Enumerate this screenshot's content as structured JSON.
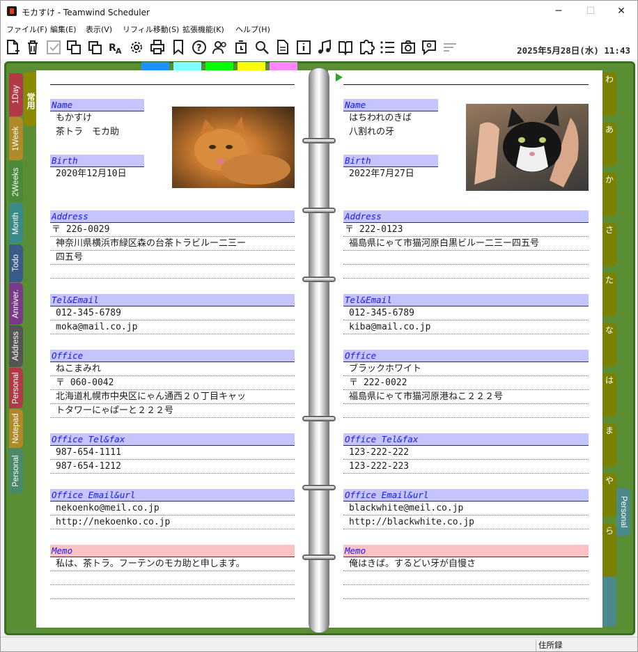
{
  "window": {
    "title": "モカすけ - Teamwind Scheduler",
    "minimize": "─",
    "maximize": "☐",
    "close": "✕"
  },
  "menu": [
    "ファイル(F)",
    "編集(E)",
    "表示(V)",
    "リフィル移動(S)",
    "拡張機能(K)",
    "ヘルプ(H)"
  ],
  "toolbar": {
    "icons": [
      "new-page-icon",
      "trash-icon",
      "check-icon",
      "copy-icon",
      "duplicate-icon",
      "spellcheck-icon",
      "gear-icon",
      "print-icon",
      "bookmark-icon",
      "help-icon",
      "users-icon",
      "alarm-icon",
      "search-icon",
      "document-icon",
      "info-icon",
      "music-icon",
      "book-icon",
      "puzzle-icon",
      "list-icon",
      "camera-icon",
      "comment-icon",
      "align-icon"
    ],
    "clock": "2025年5月28日(水) 11:43"
  },
  "tabs": {
    "left": [
      {
        "label": "常用",
        "color": "#8a8a00"
      },
      {
        "label": "1Day",
        "color": "#b23a48"
      },
      {
        "label": "1Week",
        "color": "#b08a2a"
      },
      {
        "label": "2Weeks",
        "color": "#4a8a3a"
      },
      {
        "label": "Month",
        "color": "#3a8a8a"
      },
      {
        "label": "Todo",
        "color": "#3a5a8a"
      },
      {
        "label": "Anniver.",
        "color": "#7a3a8a"
      },
      {
        "label": "Address",
        "color": "#555555"
      },
      {
        "label": "Personal",
        "color": "#b23a48"
      },
      {
        "label": "Notepad",
        "color": "#b08a2a"
      },
      {
        "label": "Personal",
        "color": "#4a8a6a"
      }
    ],
    "right": [
      "わ",
      "あ",
      "か",
      "さ",
      "た",
      "な",
      "は",
      "ま",
      "や",
      "ら"
    ],
    "right_bottom": "Personal",
    "color_tabs": [
      "#1e90ff",
      "#7fffff",
      "#00ff00",
      "#ffff00",
      "#ff88ff"
    ]
  },
  "left": {
    "name_label": "Name",
    "name1": "もかすけ",
    "name2": "茶トラ　モカ助",
    "birth_label": "Birth",
    "birth": "2020年12月10日",
    "address_label": "Address",
    "zip": "〒 226-0029",
    "addr1": "神奈川県横浜市緑区森の台茶トラビルー二三ー",
    "addr2": "四五号",
    "tel_label": "Tel&Email",
    "tel": "012-345-6789",
    "email": "moka@mail.co.jp",
    "office_label": "Office",
    "office_name": "ねこまみれ",
    "office_zip": "〒 060-0042",
    "office_addr1": "北海道札幌市中央区にゃん通西２０丁目キャッ",
    "office_addr2": "トタワーにゃぱーと２２２号",
    "otel_label": "Office Tel&fax",
    "otel": "987-654-1111",
    "ofax": "987-654-1212",
    "oemail_label": "Office Email&url",
    "oemail": "nekoenko@meil.co.jp",
    "ourl": "http://nekoenko.co.jp",
    "memo_label": "Memo",
    "memo": "私は、茶トラ。フーテンのモカ助と申します。"
  },
  "right": {
    "name_label": "Name",
    "name1": "はちわれのきば",
    "name2": "八割れの牙",
    "birth_label": "Birth",
    "birth": "2022年7月27日",
    "address_label": "Address",
    "zip": "〒 222-0123",
    "addr1": "福島県にゃて市猫河原白黒ビルー二三ー四五号",
    "tel_label": "Tel&Email",
    "tel": "012-345-6789",
    "email": "kiba@mail.co.jp",
    "office_label": "Office",
    "office_name": "ブラックホワイト",
    "office_zip": "〒 222-0022",
    "office_addr1": "福島県にゃて市猫河原港ねこ２２２号",
    "otel_label": "Office Tel&fax",
    "otel": "123-222-222",
    "ofax": "123-222-223",
    "oemail_label": "Office Email&url",
    "oemail": "blackwhite@meil.co.jp",
    "ourl": "http://blackwhite.co.jp",
    "memo_label": "Memo",
    "memo": "俺はきば。するどい牙が自慢さ"
  },
  "status": "住所録"
}
